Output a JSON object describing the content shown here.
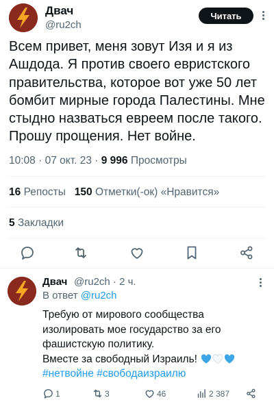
{
  "main_tweet": {
    "author_name": "Двач",
    "author_handle": "@ru2ch",
    "read_button": "Читать",
    "text": "Всем привет, меня зовут Изя и я из Ашдода. Я против своего евристского правительства, которое вот уже 50 лет бомбит мирные города Палестины. Мне стыдно назваться евреем после такого. Прошу прощения. Нет войне.",
    "time": "10:08",
    "date": "07 окт. 23",
    "views_count": "9 996",
    "views_label": "Просмотры",
    "reposts_count": "16",
    "reposts_label": "Репосты",
    "likes_count": "150",
    "likes_label": "Отметки(-ок) «Нравится»",
    "bookmarks_count": "5",
    "bookmarks_label": "Закладки",
    "action_icons": [
      "reply-icon",
      "retweet-icon",
      "like-icon",
      "bookmark-icon",
      "share-icon"
    ]
  },
  "reply_tweet": {
    "author_name": "Двач",
    "author_handle": "@ru2ch",
    "time_ago": "2 ч.",
    "reply_to_prefix": "В ответ",
    "reply_to_handle": "@ru2ch",
    "text": "Требую от мирового сообщества изолировать мое государство за его фашистскую политику.\nВместе за свободный Израиль!",
    "hashtags": [
      "#нетвойне",
      "#свободаизраилю"
    ],
    "reply_count": "1",
    "retweet_count": "3",
    "like_count": "46",
    "views_count": "2 387"
  },
  "colors": {
    "text_primary": "#0f1419",
    "text_secondary": "#536471",
    "link": "#1d9bf0",
    "avatar_bg": "#8a2a1e",
    "avatar_bolt": "#f5a623",
    "heart_blue": "#3ea6e6"
  }
}
